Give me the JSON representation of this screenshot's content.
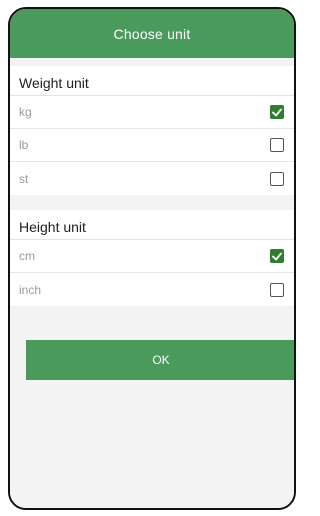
{
  "dialog": {
    "title": "Choose unit",
    "ok_label": "OK"
  },
  "weight": {
    "title": "Weight unit",
    "options": [
      {
        "label": "kg",
        "checked": true
      },
      {
        "label": "lb",
        "checked": false
      },
      {
        "label": "st",
        "checked": false
      }
    ]
  },
  "height": {
    "title": "Height unit",
    "options": [
      {
        "label": "cm",
        "checked": true
      },
      {
        "label": "inch",
        "checked": false
      }
    ]
  },
  "colors": {
    "accent": "#4a9a5c",
    "check": "#2e7d32"
  }
}
